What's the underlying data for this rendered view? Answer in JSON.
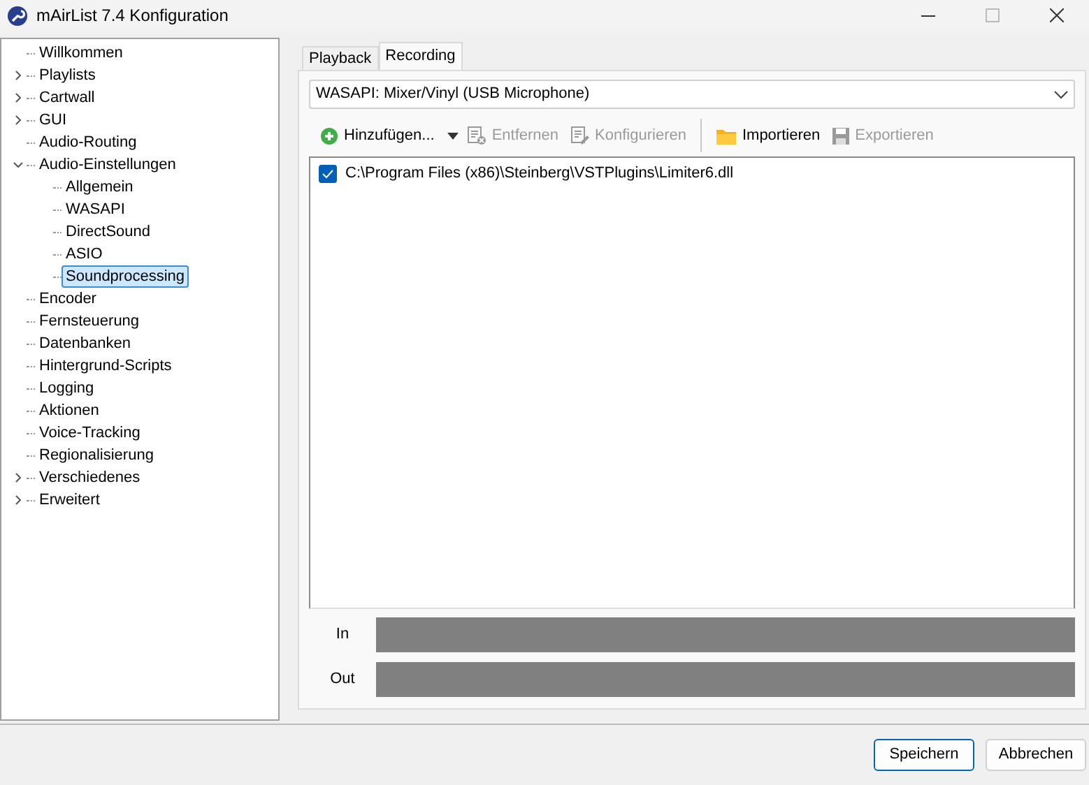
{
  "window": {
    "title": "mAirList 7.4 Konfiguration"
  },
  "tree": [
    {
      "label": "Willkommen",
      "selected": false
    },
    {
      "label": "Playlists",
      "selected": false,
      "expanded": false
    },
    {
      "label": "Cartwall",
      "selected": false,
      "expanded": false
    },
    {
      "label": "GUI",
      "selected": false,
      "expanded": false
    },
    {
      "label": "Audio-Routing",
      "selected": false
    },
    {
      "label": "Audio-Einstellungen",
      "selected": false,
      "expanded": true,
      "children": [
        {
          "label": "Allgemein",
          "selected": false
        },
        {
          "label": "WASAPI",
          "selected": false
        },
        {
          "label": "DirectSound",
          "selected": false
        },
        {
          "label": "ASIO",
          "selected": false
        },
        {
          "label": "Soundprocessing",
          "selected": true
        }
      ]
    },
    {
      "label": "Encoder",
      "selected": false
    },
    {
      "label": "Fernsteuerung",
      "selected": false
    },
    {
      "label": "Datenbanken",
      "selected": false
    },
    {
      "label": "Hintergrund-Scripts",
      "selected": false
    },
    {
      "label": "Logging",
      "selected": false
    },
    {
      "label": "Aktionen",
      "selected": false
    },
    {
      "label": "Voice-Tracking",
      "selected": false
    },
    {
      "label": "Regionalisierung",
      "selected": false
    },
    {
      "label": "Verschiedenes",
      "selected": false,
      "expanded": false
    },
    {
      "label": "Erweitert",
      "selected": false,
      "expanded": false
    }
  ],
  "tabs": [
    {
      "label": "Playback",
      "selected": false
    },
    {
      "label": "Recording",
      "selected": true
    }
  ],
  "device_select": {
    "value": "WASAPI: Mixer/Vinyl (USB Microphone)"
  },
  "toolbar": [
    {
      "kind": "add",
      "label": "Hinzufügen...",
      "disabled": false
    },
    {
      "kind": "remove",
      "label": "Entfernen",
      "disabled": true
    },
    {
      "kind": "configure",
      "label": "Konfigurieren",
      "disabled": true
    },
    {
      "kind": "import",
      "label": "Importieren",
      "disabled": false
    },
    {
      "kind": "export",
      "label": "Exportieren",
      "disabled": true
    }
  ],
  "plugins": [
    {
      "path": "C:\\Program Files (x86)\\Steinberg\\VSTPlugins\\Limiter6.dll",
      "checked": true
    }
  ],
  "meters": [
    {
      "label": "In",
      "level": 0
    },
    {
      "label": "Out",
      "level": 0
    }
  ],
  "buttons": [
    {
      "label": "Speichern",
      "default": true
    },
    {
      "label": "Abbrechen",
      "default": false
    }
  ]
}
